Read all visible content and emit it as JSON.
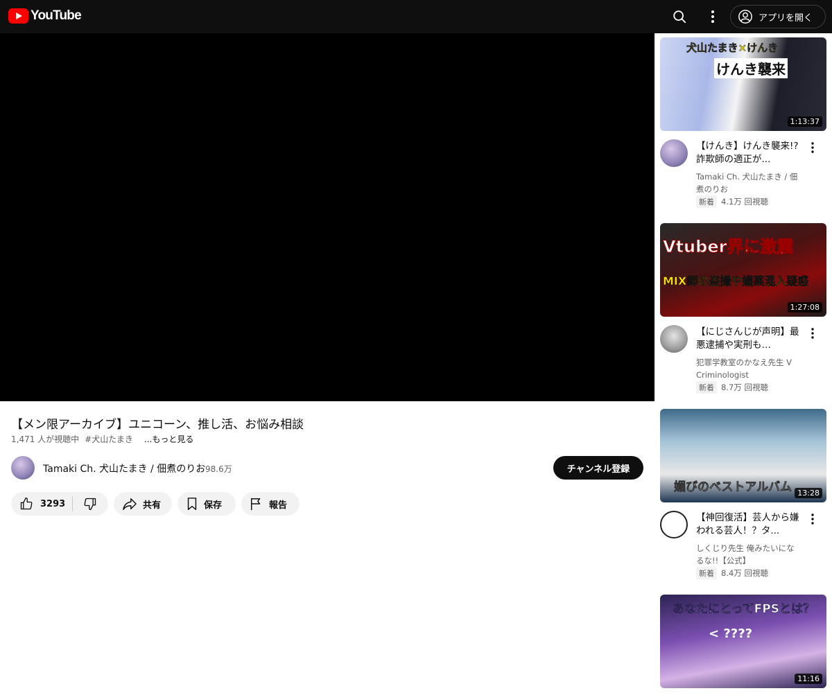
{
  "header": {
    "logo_text": "YouTube",
    "open_app_label": "アプリを開く"
  },
  "video": {
    "title": "【メン限アーカイブ】ユニコーン、推し活、お悩み相談",
    "viewers": "1,471 人が視聴中",
    "hashtag": "#犬山たまき",
    "more": "...もっと見る"
  },
  "channel": {
    "name": "Tamaki Ch. 犬山たまき / 佃煮のりお",
    "subscribers": "98.6万",
    "subscribe_label": "チャンネル登録"
  },
  "actions": {
    "like_count": "3293",
    "share_label": "共有",
    "save_label": "保存",
    "report_label": "報告"
  },
  "recommendations": [
    {
      "title": "【けんき】けんき襲来!? 詐欺師の適正が...",
      "channel": "Tamaki Ch. 犬山たまき / 佃煮のりお",
      "badge": "新着",
      "views": "4.1万 回視聴",
      "duration": "1:13:37",
      "thumb_text_1": "犬山たまき×けんき",
      "thumb_text_2": "けんき襲来"
    },
    {
      "title": "【にじさんじが声明】最悪逮捕や実刑も…",
      "channel": "犯罪学教室のかなえ先生 V Criminologist",
      "badge": "新着",
      "views": "8.7万 回視聴",
      "duration": "1:27:08",
      "thumb_text_1": "Vtuber界に激震",
      "thumb_text_2": "MIX師の盗撮や媚薬混入疑惑"
    },
    {
      "title": "【神回復活】芸人から嫌われる芸人！？タ...",
      "channel": "しくじり先生 俺みたいになるな!!【公式】",
      "badge": "新着",
      "views": "8.4万 回視聴",
      "duration": "13:28",
      "thumb_text_1": "媚びのベストアルバム"
    },
    {
      "duration": "11:16",
      "thumb_text_1": "あなたにとってFPSとは？",
      "thumb_text_2": "< ????"
    }
  ]
}
